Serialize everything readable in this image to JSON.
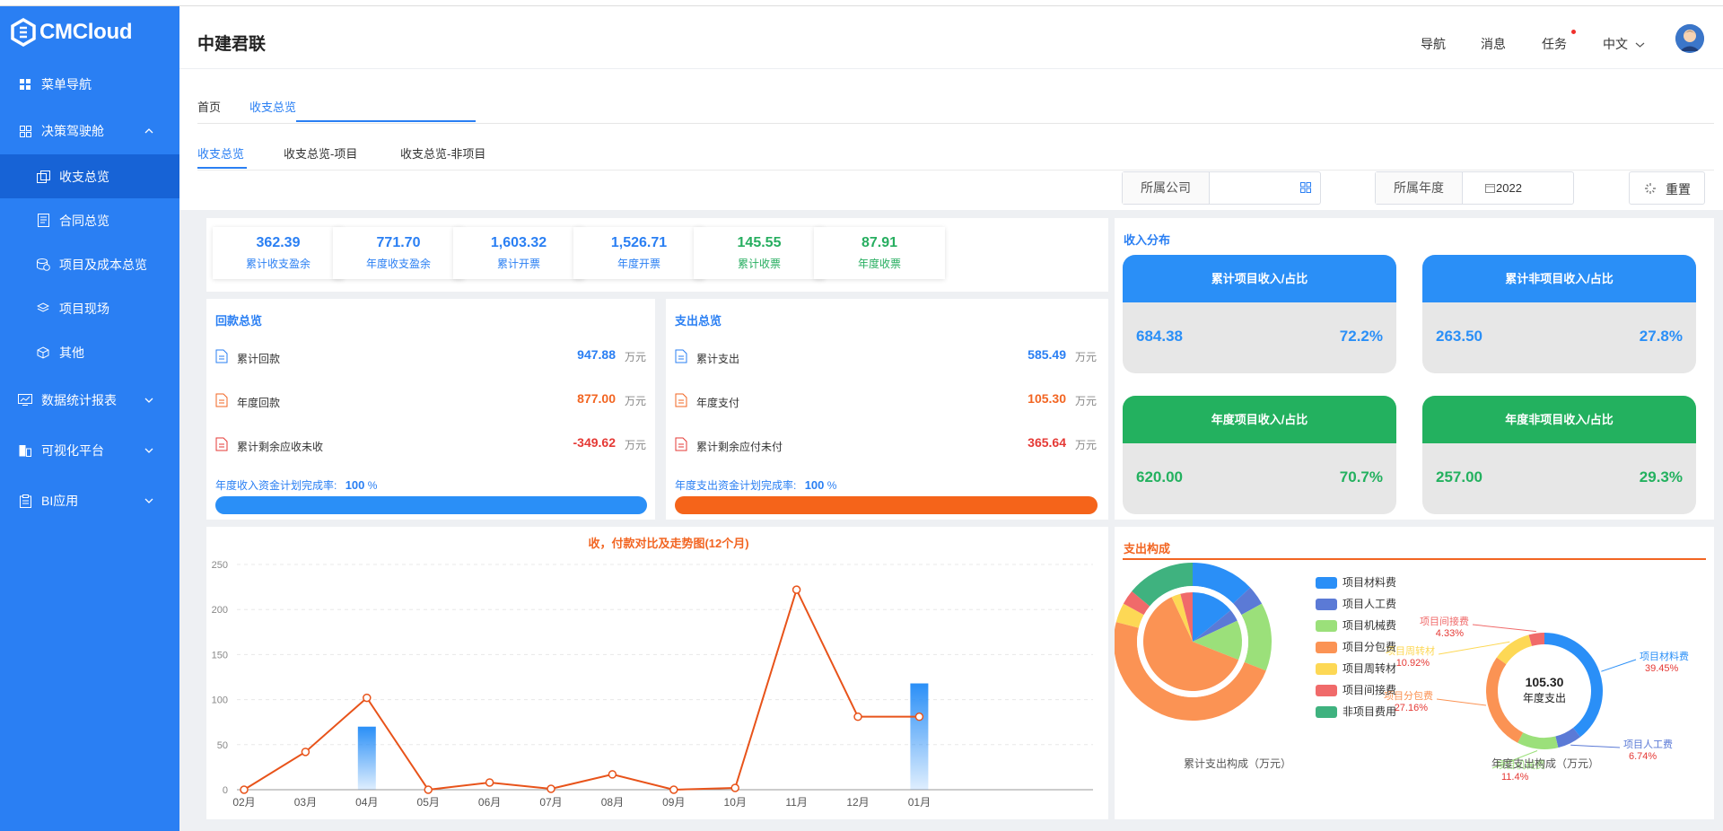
{
  "brand": {
    "name": "CMCloud"
  },
  "sidebar": {
    "items": [
      {
        "label": "菜单导航"
      },
      {
        "label": "决策驾驶舱"
      },
      {
        "label": "收支总览"
      },
      {
        "label": "合同总览"
      },
      {
        "label": "项目及成本总览"
      },
      {
        "label": "项目现场"
      },
      {
        "label": "其他"
      },
      {
        "label": "数据统计报表"
      },
      {
        "label": "可视化平台"
      },
      {
        "label": "BI应用"
      }
    ]
  },
  "header": {
    "title": "中建君联",
    "nav": "导航",
    "messages": "消息",
    "tasks": "任务",
    "language": "中文"
  },
  "tabs": {
    "home": "首页",
    "current": "收支总览"
  },
  "subtabs": [
    "收支总览",
    "收支总览-项目",
    "收支总览-非项目"
  ],
  "filters": {
    "company_label": "所属公司",
    "company_value": "",
    "year_label": "所属年度",
    "year_value": "2022",
    "reset_label": "重置"
  },
  "stats": [
    {
      "value": "362.39",
      "label": "累计收支盈余",
      "color": "#2a7ff3"
    },
    {
      "value": "771.70",
      "label": "年度收支盈余",
      "color": "#2a7ff3"
    },
    {
      "value": "1,603.32",
      "label": "累计开票",
      "color": "#2a7ff3"
    },
    {
      "value": "1,526.71",
      "label": "年度开票",
      "color": "#2a7ff3"
    },
    {
      "value": "145.55",
      "label": "累计收票",
      "color": "#27ae60"
    },
    {
      "value": "87.91",
      "label": "年度收票",
      "color": "#27ae60"
    }
  ],
  "receipts": {
    "title": "回款总览",
    "rows": [
      {
        "label": "累计回款",
        "value": "947.88",
        "unit": "万元",
        "color": "#2a7ff3"
      },
      {
        "label": "年度回款",
        "value": "877.00",
        "unit": "万元",
        "color": "#f26522"
      },
      {
        "label": "累计剩余应收未收",
        "value": "-349.62",
        "unit": "万元",
        "color": "#e53935"
      }
    ],
    "progress_label": "年度收入资金计划完成率:",
    "progress_value": "100",
    "progress_unit": "%",
    "progress_fraction": 1.0,
    "bar_color": "#2a8ff7"
  },
  "expenses": {
    "title": "支出总览",
    "rows": [
      {
        "label": "累计支出",
        "value": "585.49",
        "unit": "万元",
        "color": "#2a7ff3"
      },
      {
        "label": "年度支付",
        "value": "105.30",
        "unit": "万元",
        "color": "#f26522"
      },
      {
        "label": "累计剩余应付未付",
        "value": "365.64",
        "unit": "万元",
        "color": "#e53935"
      }
    ],
    "progress_label": "年度支出资金计划完成率:",
    "progress_value": "100",
    "progress_unit": "%",
    "progress_fraction": 1.0,
    "bar_color": "#f5641a"
  },
  "income": {
    "title": "收入分布",
    "cards": [
      {
        "header": "累计项目收入/占比",
        "amount": "684.38",
        "pct": "72.2%",
        "color": "#2a8ff7"
      },
      {
        "header": "累计非项目收入/占比",
        "amount": "263.50",
        "pct": "27.8%",
        "color": "#2a8ff7"
      },
      {
        "header": "年度项目收入/占比",
        "amount": "620.00",
        "pct": "70.7%",
        "color": "#23b15f"
      },
      {
        "header": "年度非项目收入/占比",
        "amount": "257.00",
        "pct": "29.3%",
        "color": "#23b15f"
      }
    ]
  },
  "chart_data": [
    {
      "type": "line",
      "title": "收，付款对比及走势图(12个月)",
      "categories": [
        "02月",
        "03月",
        "04月",
        "05月",
        "06月",
        "07月",
        "08月",
        "09月",
        "10月",
        "11月",
        "12月",
        "01月"
      ],
      "yticks": [
        0,
        50,
        100,
        150,
        200,
        250
      ],
      "ylim": [
        0,
        250
      ],
      "series": [
        {
          "type": "line",
          "values": [
            0,
            42,
            102,
            0,
            8,
            1,
            17,
            0,
            2,
            222,
            81,
            81
          ],
          "color": "#e8531a"
        },
        {
          "type": "bar",
          "values": [
            0,
            0,
            70,
            0,
            0,
            0,
            0,
            0,
            0,
            0,
            0,
            118
          ],
          "color": "#2a8ff7"
        }
      ]
    },
    {
      "type": "pie",
      "title": "支出构成",
      "caption": "累计支出构成（万元）",
      "categories": [
        "项目材料费",
        "项目人工费",
        "项目机械费",
        "项目分包费",
        "项目周转材",
        "项目间接费",
        "非项目费用"
      ],
      "colors": [
        "#2a8ff7",
        "#5b7ad6",
        "#9be07a",
        "#fb9354",
        "#fdd855",
        "#f06a6a",
        "#3fb27f"
      ],
      "outer": [
        13,
        4,
        14,
        48,
        4,
        3,
        14
      ],
      "inner": [
        14,
        4,
        13,
        62,
        3,
        4,
        0
      ]
    },
    {
      "type": "pie",
      "caption": "年度支出构成（万元）",
      "center_value": "105.30",
      "center_label": "年度支出",
      "values": [
        39.45,
        6.74,
        11.4,
        27.16,
        10.92,
        4.33
      ],
      "labels": [
        {
          "name": "项目材料费",
          "pct": "39.45%"
        },
        {
          "name": "项目人工费",
          "pct": "6.74%"
        },
        {
          "name": "项目机械费",
          "pct": "11.4%"
        },
        {
          "name": "项目分包费",
          "pct": "27.16%"
        },
        {
          "name": "项目周转材",
          "pct": "10.92%"
        },
        {
          "name": "项目间接费",
          "pct": "4.33%"
        }
      ],
      "colors": [
        "#2a8ff7",
        "#5b7ad6",
        "#9be07a",
        "#fb9354",
        "#fdd855",
        "#f06a6a"
      ]
    }
  ]
}
